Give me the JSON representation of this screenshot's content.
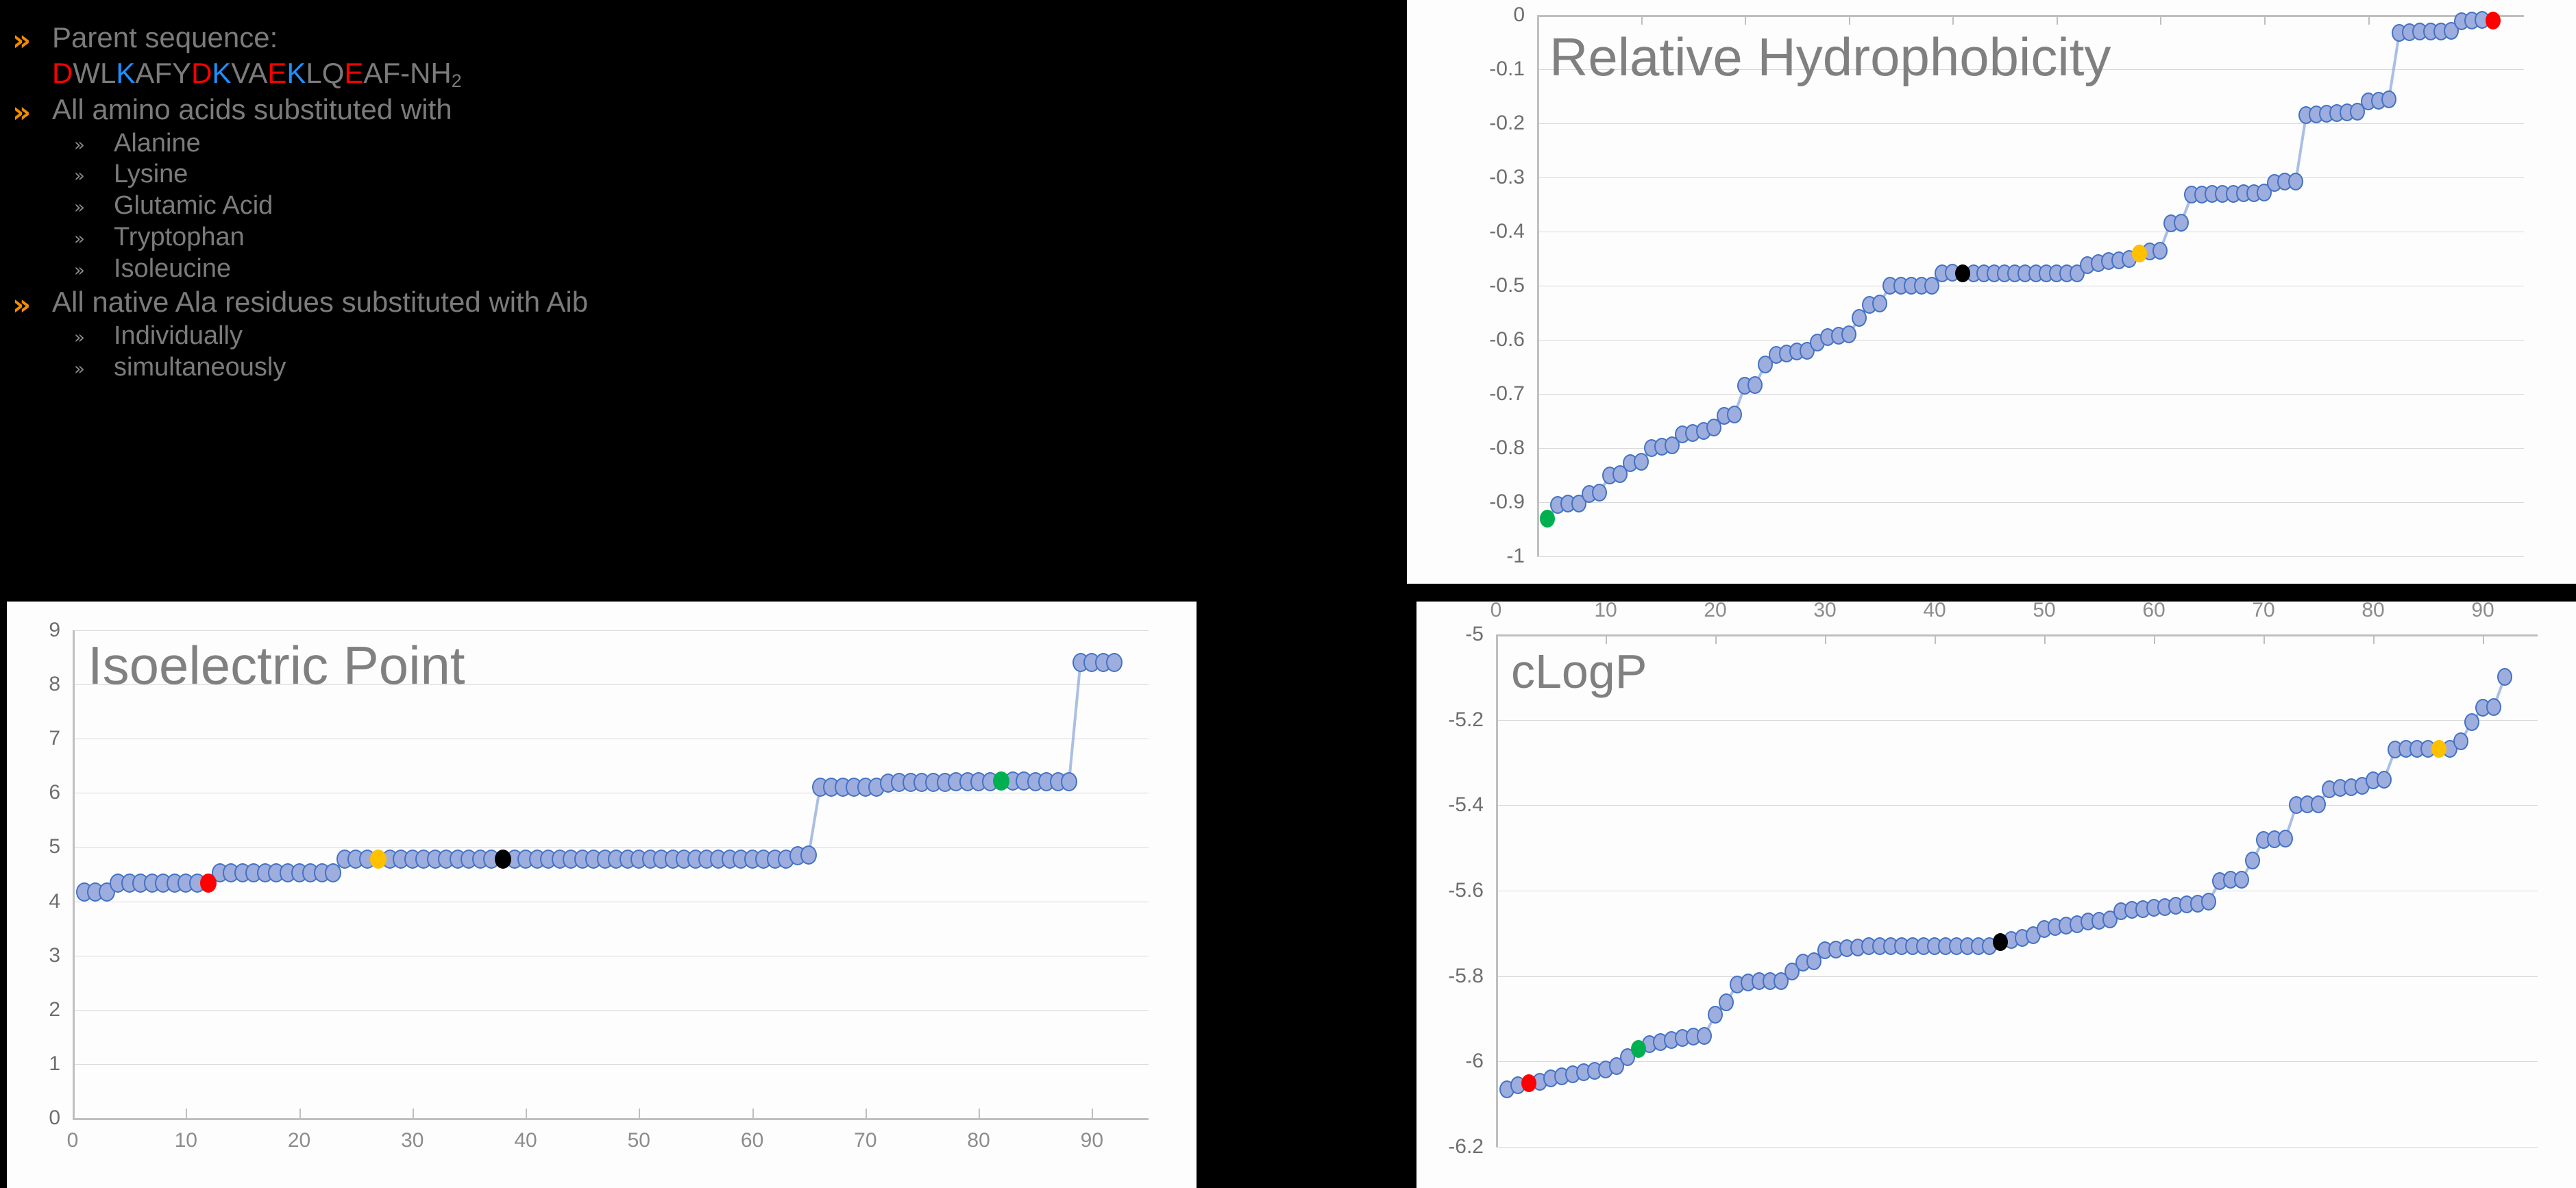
{
  "slide": {
    "background": "#000000",
    "bullet_color": "#F08C00",
    "text_color": "#7B7B7B"
  },
  "text_panel": {
    "bullet_glyph": "»",
    "sub_bullet_glyph": "»",
    "items": [
      {
        "level": 1,
        "label": "Parent sequence:"
      },
      {
        "level": 1,
        "label": "All amino acids substituted with"
      },
      {
        "level": 2,
        "label": "Alanine"
      },
      {
        "level": 2,
        "label": "Lysine"
      },
      {
        "level": 2,
        "label": "Glutamic Acid"
      },
      {
        "level": 2,
        "label": "Tryptophan"
      },
      {
        "level": 2,
        "label": "Isoleucine"
      },
      {
        "level": 1,
        "label": "All native Ala residues substituted with Aib"
      },
      {
        "level": 2,
        "label": "Individually"
      },
      {
        "level": 2,
        "label": "simultaneously"
      }
    ],
    "sequence": {
      "plain_text": "DWLKAFYDKVAEKLQEAF-NH2",
      "residue_colors": {
        "acidic": "#FF0000",
        "basic": "#1E90FF",
        "neutral": "#7B7B7B"
      },
      "residues": [
        {
          "c": "D",
          "t": "acidic"
        },
        {
          "c": "W",
          "t": "neutral"
        },
        {
          "c": "L",
          "t": "neutral"
        },
        {
          "c": "K",
          "t": "basic"
        },
        {
          "c": "A",
          "t": "neutral"
        },
        {
          "c": "F",
          "t": "neutral"
        },
        {
          "c": "Y",
          "t": "neutral"
        },
        {
          "c": "D",
          "t": "acidic"
        },
        {
          "c": "K",
          "t": "basic"
        },
        {
          "c": "V",
          "t": "neutral"
        },
        {
          "c": "A",
          "t": "neutral"
        },
        {
          "c": "E",
          "t": "acidic"
        },
        {
          "c": "K",
          "t": "basic"
        },
        {
          "c": "L",
          "t": "neutral"
        },
        {
          "c": "Q",
          "t": "neutral"
        },
        {
          "c": "E",
          "t": "acidic"
        },
        {
          "c": "A",
          "t": "neutral"
        },
        {
          "c": "F",
          "t": "neutral"
        },
        {
          "c": "-NH",
          "t": "neutral"
        },
        {
          "c": "2",
          "t": "sub"
        }
      ]
    }
  },
  "marker_legend": {
    "series_fill": "#9DADDE",
    "series_stroke": "#4472C4",
    "highlight_red": "#FF0000",
    "highlight_green": "#00B050",
    "highlight_yellow": "#FFC000",
    "highlight_black": "#000000",
    "line_color": "#8EA9DB"
  },
  "chart_data": [
    {
      "id": "hydrophobicity",
      "type": "scatter",
      "title": "Relative Hydrophobicity",
      "xlabel": "",
      "ylabel": "",
      "xlim": [
        0,
        95
      ],
      "ylim": [
        -1,
        0
      ],
      "x_axis_position": "top",
      "grid": true,
      "xticks": [
        0,
        10,
        20,
        30,
        40,
        50,
        60,
        70,
        80,
        90
      ],
      "yticks": [
        0,
        -0.1,
        -0.2,
        -0.3,
        -0.4,
        -0.5,
        -0.6,
        -0.7,
        -0.8,
        -0.9,
        -1
      ],
      "ytick_labels": [
        "0",
        "-0.1",
        "-0.2",
        "-0.3",
        "-0.4",
        "-0.5",
        "-0.6",
        "-0.7",
        "-0.8",
        "-0.9",
        "-1"
      ],
      "x": [
        1,
        2,
        3,
        4,
        5,
        6,
        7,
        8,
        9,
        10,
        11,
        12,
        13,
        14,
        15,
        16,
        17,
        18,
        19,
        20,
        21,
        22,
        23,
        24,
        25,
        26,
        27,
        28,
        29,
        30,
        31,
        32,
        33,
        34,
        35,
        36,
        37,
        38,
        39,
        40,
        41,
        42,
        43,
        44,
        45,
        46,
        47,
        48,
        49,
        50,
        51,
        52,
        53,
        54,
        55,
        56,
        57,
        58,
        59,
        60,
        61,
        62,
        63,
        64,
        65,
        66,
        67,
        68,
        69,
        70,
        71,
        72,
        73,
        74,
        75,
        76,
        77,
        78,
        79,
        80,
        81,
        82,
        83,
        84,
        85,
        86,
        87,
        88,
        89,
        90,
        91,
        92
      ],
      "values": [
        -0.93,
        -0.905,
        -0.903,
        -0.902,
        -0.885,
        -0.882,
        -0.85,
        -0.848,
        -0.828,
        -0.825,
        -0.8,
        -0.798,
        -0.795,
        -0.775,
        -0.772,
        -0.768,
        -0.762,
        -0.74,
        -0.738,
        -0.685,
        -0.683,
        -0.645,
        -0.628,
        -0.625,
        -0.622,
        -0.62,
        -0.605,
        -0.595,
        -0.592,
        -0.59,
        -0.56,
        -0.535,
        -0.533,
        -0.5,
        -0.5,
        -0.5,
        -0.5,
        -0.5,
        -0.477,
        -0.476,
        -0.477,
        -0.477,
        -0.477,
        -0.477,
        -0.477,
        -0.477,
        -0.477,
        -0.477,
        -0.477,
        -0.477,
        -0.477,
        -0.477,
        -0.462,
        -0.458,
        -0.455,
        -0.453,
        -0.45,
        -0.44,
        -0.437,
        -0.436,
        -0.385,
        -0.383,
        -0.332,
        -0.332,
        -0.33,
        -0.33,
        -0.33,
        -0.329,
        -0.329,
        -0.328,
        -0.31,
        -0.308,
        -0.307,
        -0.185,
        -0.183,
        -0.182,
        -0.181,
        -0.18,
        -0.178,
        -0.16,
        -0.158,
        -0.156,
        -0.033,
        -0.032,
        -0.031,
        -0.03,
        -0.03,
        -0.029,
        -0.012,
        -0.01,
        -0.009,
        -0.01
      ],
      "highlights": [
        {
          "index": 0,
          "color": "#00B050",
          "name": "parent-green"
        },
        {
          "index": 40,
          "color": "#000000",
          "name": "reference-black"
        },
        {
          "index": 57,
          "color": "#FFC000",
          "name": "reference-yellow"
        },
        {
          "index": 91,
          "color": "#FF0000",
          "name": "reference-red"
        }
      ]
    },
    {
      "id": "isoelectric_point",
      "type": "scatter",
      "title": "Isoelectric Point",
      "xlabel": "",
      "ylabel": "",
      "xlim": [
        0,
        95
      ],
      "ylim": [
        0,
        9
      ],
      "x_axis_position": "bottom",
      "grid": true,
      "xticks": [
        0,
        10,
        20,
        30,
        40,
        50,
        60,
        70,
        80,
        90
      ],
      "yticks": [
        0,
        1,
        2,
        3,
        4,
        5,
        6,
        7,
        8,
        9
      ],
      "ytick_labels": [
        "0",
        "1",
        "2",
        "3",
        "4",
        "5",
        "6",
        "7",
        "8",
        "9"
      ],
      "x": [
        1,
        2,
        3,
        4,
        5,
        6,
        7,
        8,
        9,
        10,
        11,
        12,
        13,
        14,
        15,
        16,
        17,
        18,
        19,
        20,
        21,
        22,
        23,
        24,
        25,
        26,
        27,
        28,
        29,
        30,
        31,
        32,
        33,
        34,
        35,
        36,
        37,
        38,
        39,
        40,
        41,
        42,
        43,
        44,
        45,
        46,
        47,
        48,
        49,
        50,
        51,
        52,
        53,
        54,
        55,
        56,
        57,
        58,
        59,
        60,
        61,
        62,
        63,
        64,
        65,
        66,
        67,
        68,
        69,
        70,
        71,
        72,
        73,
        74,
        75,
        76,
        77,
        78,
        79,
        80,
        81,
        82,
        83,
        84,
        85,
        86,
        87,
        88,
        89,
        90,
        91,
        92
      ],
      "values": [
        4.17,
        4.17,
        4.17,
        4.34,
        4.34,
        4.34,
        4.34,
        4.34,
        4.34,
        4.34,
        4.34,
        4.34,
        4.52,
        4.52,
        4.53,
        4.53,
        4.53,
        4.53,
        4.53,
        4.53,
        4.53,
        4.53,
        4.53,
        4.78,
        4.78,
        4.78,
        4.78,
        4.78,
        4.78,
        4.78,
        4.78,
        4.78,
        4.78,
        4.78,
        4.78,
        4.78,
        4.78,
        4.78,
        4.78,
        4.78,
        4.78,
        4.78,
        4.78,
        4.78,
        4.78,
        4.78,
        4.78,
        4.78,
        4.78,
        4.78,
        4.78,
        4.78,
        4.78,
        4.78,
        4.78,
        4.78,
        4.78,
        4.78,
        4.78,
        4.78,
        4.78,
        4.78,
        4.78,
        4.84,
        4.85,
        6.1,
        6.1,
        6.11,
        6.11,
        6.11,
        6.11,
        6.18,
        6.19,
        6.19,
        6.19,
        6.2,
        6.2,
        6.21,
        6.21,
        6.21,
        6.21,
        6.22,
        6.22,
        6.22,
        6.21,
        6.21,
        6.21,
        6.21,
        8.4,
        8.4,
        8.4,
        8.4
      ],
      "highlights": [
        {
          "index": 11,
          "color": "#FF0000",
          "name": "reference-red"
        },
        {
          "index": 26,
          "color": "#FFC000",
          "name": "reference-yellow"
        },
        {
          "index": 37,
          "color": "#000000",
          "name": "reference-black"
        },
        {
          "index": 81,
          "color": "#00B050",
          "name": "reference-green"
        }
      ]
    },
    {
      "id": "clogp",
      "type": "scatter",
      "title": "cLogP",
      "xlabel": "",
      "ylabel": "",
      "xlim": [
        0,
        95
      ],
      "ylim": [
        -6.2,
        -5.0
      ],
      "x_axis_position": "top",
      "grid": true,
      "xticks": [
        0,
        10,
        20,
        30,
        40,
        50,
        60,
        70,
        80,
        90
      ],
      "yticks": [
        -5,
        -5.2,
        -5.4,
        -5.6,
        -5.8,
        -6,
        -6.2
      ],
      "ytick_labels": [
        "-5",
        "-5.2",
        "-5.4",
        "-5.6",
        "-5.8",
        "-6",
        "-6.2"
      ],
      "x": [
        1,
        2,
        3,
        4,
        5,
        6,
        7,
        8,
        9,
        10,
        11,
        12,
        13,
        14,
        15,
        16,
        17,
        18,
        19,
        20,
        21,
        22,
        23,
        24,
        25,
        26,
        27,
        28,
        29,
        30,
        31,
        32,
        33,
        34,
        35,
        36,
        37,
        38,
        39,
        40,
        41,
        42,
        43,
        44,
        45,
        46,
        47,
        48,
        49,
        50,
        51,
        52,
        53,
        54,
        55,
        56,
        57,
        58,
        59,
        60,
        61,
        62,
        63,
        64,
        65,
        66,
        67,
        68,
        69,
        70,
        71,
        72,
        73,
        74,
        75,
        76,
        77,
        78,
        79,
        80,
        81,
        82,
        83,
        84,
        85,
        86,
        87,
        88,
        89,
        90,
        91,
        92
      ],
      "values": [
        -6.065,
        -6.055,
        -6.05,
        -6.048,
        -6.04,
        -6.035,
        -6.03,
        -6.025,
        -6.022,
        -6.018,
        -6.01,
        -5.99,
        -5.97,
        -5.96,
        -5.955,
        -5.95,
        -5.945,
        -5.942,
        -5.94,
        -5.89,
        -5.862,
        -5.82,
        -5.815,
        -5.812,
        -5.812,
        -5.812,
        -5.79,
        -5.768,
        -5.765,
        -5.74,
        -5.738,
        -5.735,
        -5.733,
        -5.73,
        -5.73,
        -5.73,
        -5.73,
        -5.73,
        -5.73,
        -5.73,
        -5.73,
        -5.73,
        -5.73,
        -5.73,
        -5.73,
        -5.72,
        -5.715,
        -5.71,
        -5.705,
        -5.69,
        -5.685,
        -5.682,
        -5.678,
        -5.672,
        -5.67,
        -5.668,
        -5.648,
        -5.645,
        -5.643,
        -5.64,
        -5.638,
        -5.635,
        -5.632,
        -5.63,
        -5.625,
        -5.578,
        -5.575,
        -5.575,
        -5.53,
        -5.482,
        -5.48,
        -5.478,
        -5.4,
        -5.398,
        -5.398,
        -5.362,
        -5.36,
        -5.358,
        -5.355,
        -5.342,
        -5.34,
        -5.27,
        -5.268,
        -5.268,
        -5.268,
        -5.268,
        -5.268,
        -5.25,
        -5.205,
        -5.172,
        -5.17,
        -5.1
      ],
      "highlights": [
        {
          "index": 2,
          "color": "#FF0000",
          "name": "reference-red"
        },
        {
          "index": 12,
          "color": "#00B050",
          "name": "reference-green"
        },
        {
          "index": 45,
          "color": "#000000",
          "name": "reference-black"
        },
        {
          "index": 85,
          "color": "#FFC000",
          "name": "reference-yellow"
        }
      ]
    }
  ]
}
